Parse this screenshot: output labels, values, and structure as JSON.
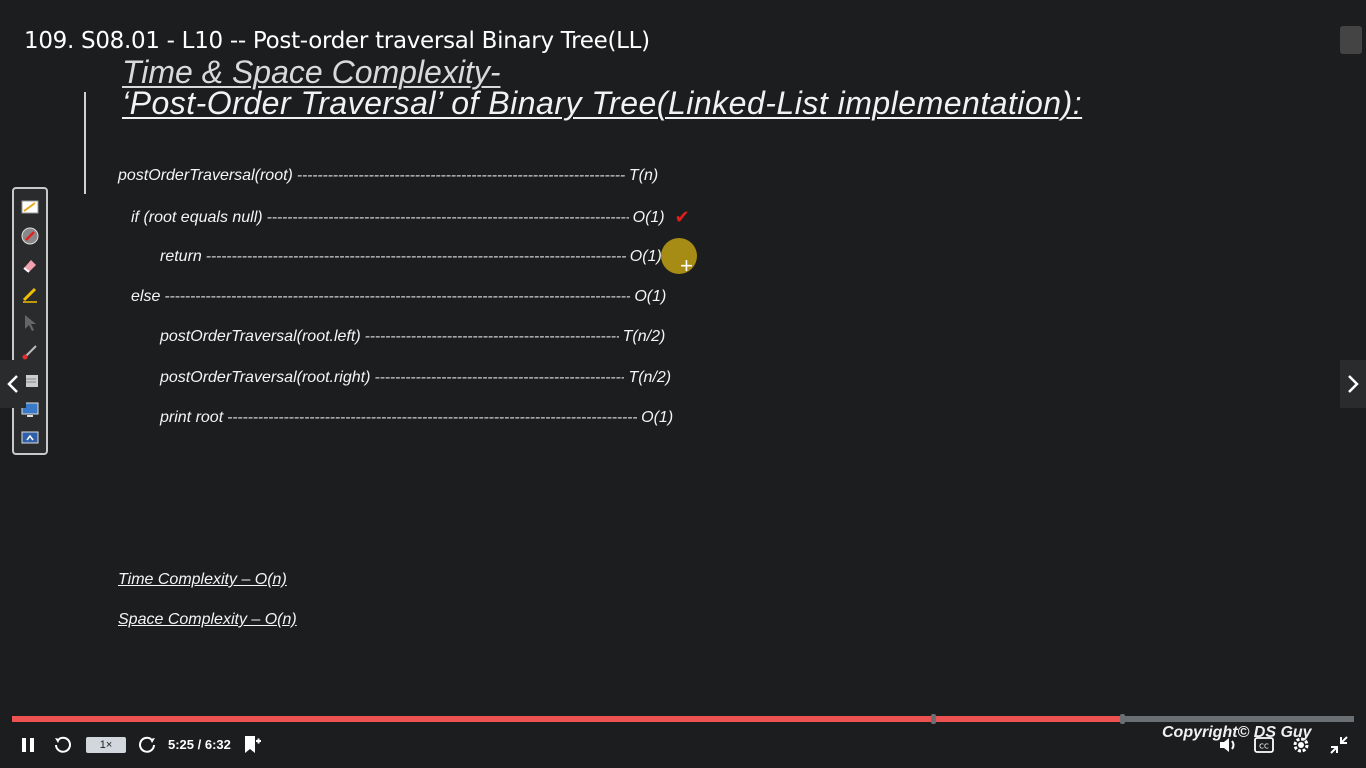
{
  "video": {
    "title": "109. S08.01 - L10 -- Post-order traversal Binary Tree(LL)"
  },
  "slide": {
    "heading_line1": "Time & Space Complexity-",
    "heading_line2": "‘Post-Order Traversal’ of Binary Tree(Linked-List implementation):",
    "code_lines": [
      {
        "code": "postOrderTraversal(root)",
        "complexity": "T(n)"
      },
      {
        "code": "if (root equals null)",
        "complexity": "O(1)"
      },
      {
        "code": "return",
        "complexity": "O(1)"
      },
      {
        "code": "else",
        "complexity": "O(1)"
      },
      {
        "code": "postOrderTraversal(root.left)",
        "complexity": "T(n/2)"
      },
      {
        "code": "postOrderTraversal(root.right)",
        "complexity": "T(n/2)"
      },
      {
        "code": "print root",
        "complexity": "O(1)"
      }
    ],
    "time_complexity": "Time Complexity – O(n)",
    "space_complexity": "Space Complexity – O(n)",
    "check_mark": "✔",
    "copyright": "Copyright© DS Guy"
  },
  "player": {
    "speed_label": "1×",
    "time_label": "5:25 / 6:32",
    "progress_fraction": 0.827,
    "bookmark_fraction": 0.686,
    "accent_color": "#ec5252"
  },
  "annotation_tools": [
    "highlighter-icon",
    "laser-pointer-icon",
    "eraser-icon",
    "pen-icon",
    "pointer-icon",
    "brush-icon",
    "whiteboard-icon",
    "screen-capture-icon",
    "screen-share-icon"
  ]
}
